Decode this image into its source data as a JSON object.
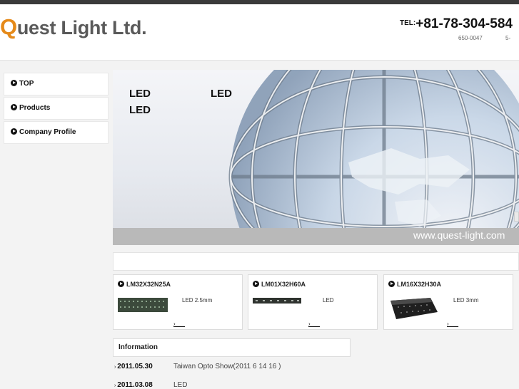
{
  "header": {
    "logo_q": "Q",
    "logo_rest": "uest Light Ltd.",
    "tel_label": "TEL:",
    "tel_number": "+81-78-304-584",
    "zip": "650-0047",
    "address_cut": "5-"
  },
  "sidebar": {
    "items": [
      {
        "label": "TOP"
      },
      {
        "label": "Products"
      },
      {
        "label": "Company Profile"
      }
    ]
  },
  "hero": {
    "text1": "LED",
    "text2": "LED",
    "text3": "LED",
    "url": "www.quest-light.com"
  },
  "products": [
    {
      "model": "LM32X32N25A",
      "desc": "LED  2.5mm",
      "more": "›___"
    },
    {
      "model": "LM01X32H60A",
      "desc": "LED",
      "more": "›___"
    },
    {
      "model": "LM16X32H30A",
      "desc": "LED  3mm",
      "more": "›___"
    }
  ],
  "information": {
    "title": "Information",
    "items": [
      {
        "date": "2011.05.30",
        "text": "Taiwan Opto Show(2011  6  14   16 )"
      },
      {
        "date": "2011.03.08",
        "text": "LED"
      }
    ]
  },
  "colors": {
    "logo_accent": "#e58a1a",
    "logo_text": "#5a5a5a",
    "topbar": "#3a3a3a"
  }
}
